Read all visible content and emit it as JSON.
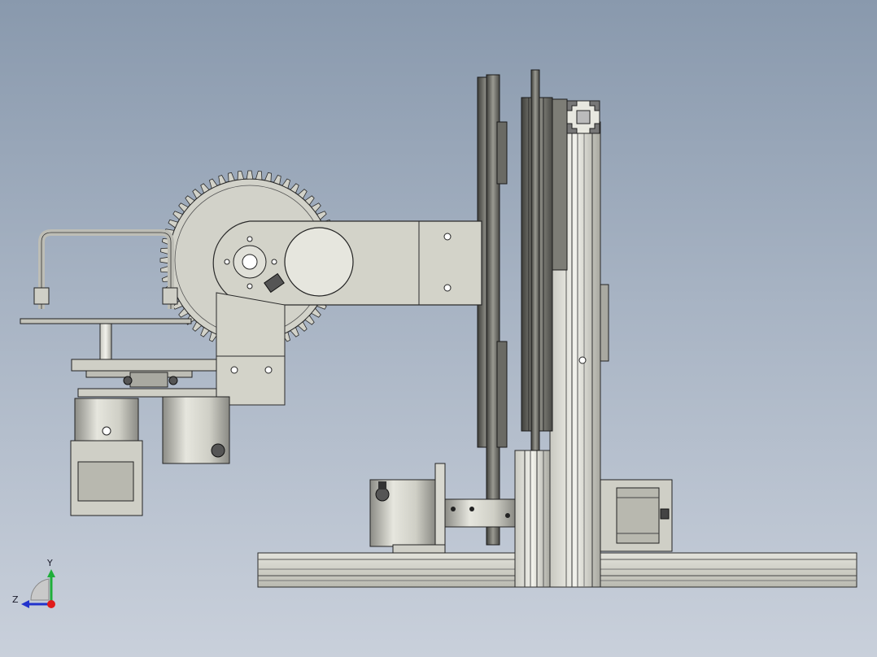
{
  "viewport": {
    "background_top": "#8999ad",
    "background_bottom": "#c9d0db"
  },
  "model": {
    "part_fill": "#d6d6cc",
    "part_stroke": "#2a2a2a",
    "dark_fill": "#5a5a55"
  },
  "triad": {
    "y_label": "Y",
    "z_label": "Z",
    "y_color": "#1fae3a",
    "z_color": "#2233cc",
    "x_color": "#e01b1b"
  }
}
